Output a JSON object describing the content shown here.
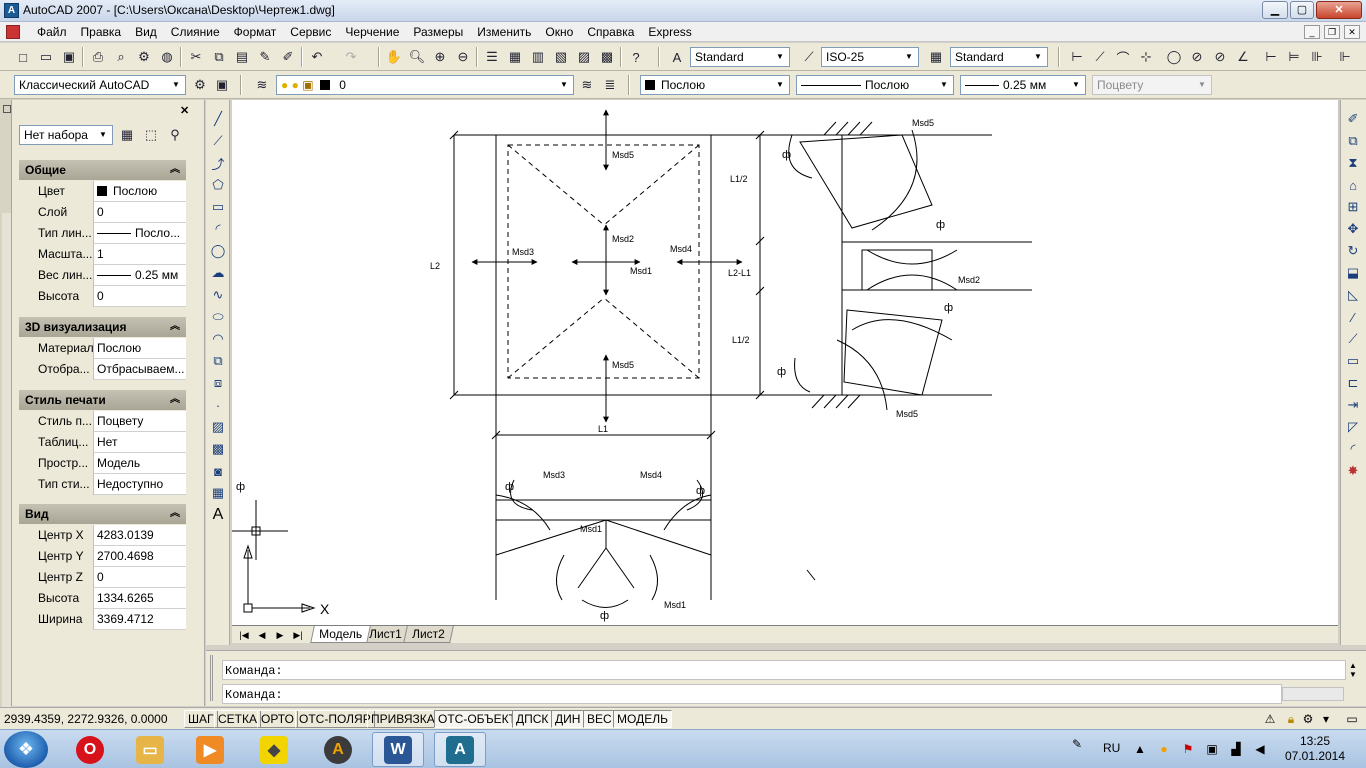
{
  "window": {
    "title": "AutoCAD 2007 - [C:\\Users\\Оксана\\Desktop\\Чертеж1.dwg]",
    "min": "▁",
    "max": "▢",
    "close": "✕"
  },
  "menu": [
    "Файл",
    "Правка",
    "Вид",
    "Слияние",
    "Формат",
    "Сервис",
    "Черчение",
    "Размеры",
    "Изменить",
    "Окно",
    "Справка",
    "Express"
  ],
  "toolbar": {
    "text_style": "Standard",
    "dim_style": "ISO-25",
    "table_style": "Standard",
    "workspace": "Классический AutoCAD",
    "layer": "0",
    "color": "Послою",
    "linetype": "Послою",
    "lineweight": "0.25 мм",
    "plotstyle": "Поцвету"
  },
  "properties": {
    "selection": "Нет набора",
    "sections": {
      "general": {
        "title": "Общие",
        "rows": [
          {
            "k": "Цвет",
            "v": "Послою"
          },
          {
            "k": "Слой",
            "v": "0"
          },
          {
            "k": "Тип лин...",
            "v": "Посло..."
          },
          {
            "k": "Масшта...",
            "v": "1"
          },
          {
            "k": "Вес лин...",
            "v": "0.25 мм"
          },
          {
            "k": "Высота",
            "v": "0"
          }
        ]
      },
      "viz3d": {
        "title": "3D визуализация",
        "rows": [
          {
            "k": "Материал",
            "v": "Послою"
          },
          {
            "k": "Отобра...",
            "v": "Отбрасываем..."
          }
        ]
      },
      "plot": {
        "title": "Стиль печати",
        "rows": [
          {
            "k": "Стиль п...",
            "v": "Поцвету"
          },
          {
            "k": "Таблиц...",
            "v": "Нет"
          },
          {
            "k": "Простр...",
            "v": "Модель"
          },
          {
            "k": "Тип сти...",
            "v": "Недоступно"
          }
        ]
      },
      "view": {
        "title": "Вид",
        "rows": [
          {
            "k": "Центр X",
            "v": "4283.0139"
          },
          {
            "k": "Центр Y",
            "v": "2700.4698"
          },
          {
            "k": "Центр Z",
            "v": "0"
          },
          {
            "k": "Высота",
            "v": "1334.6265"
          },
          {
            "k": "Ширина",
            "v": "3369.4712"
          }
        ]
      }
    }
  },
  "drawing": {
    "labels": {
      "msd5_top": "Msd5",
      "msd2": "Msd2",
      "msd3": "Msd3",
      "msd4": "Msd4",
      "msd1": "Msd1",
      "msd5_bottom": "Msd5",
      "l2": "L2",
      "l1_half_top": "L1/2",
      "l2_minus_l1": "L2-L1",
      "l1_half_bottom": "L1/2",
      "l1": "L1",
      "phi": "ф",
      "right_msd5_top": "Msd5",
      "right_msd2": "Msd2",
      "right_msd5_bottom": "Msd5",
      "bottom_msd3": "Msd3",
      "bottom_msd4": "Msd4",
      "bottom_msd1_center": "Msd1",
      "bottom_msd1_right": "Msd1"
    },
    "ucs_x": "X"
  },
  "tabs": [
    "Модель",
    "Лист1",
    "Лист2"
  ],
  "command": {
    "line1": "Команда:",
    "line2": "Команда:"
  },
  "status": {
    "coords": "2939.4359, 2272.9326, 0.0000",
    "toggles": [
      {
        "label": "ШАГ",
        "on": false
      },
      {
        "label": "СЕТКА",
        "on": false
      },
      {
        "label": "ОРТО",
        "on": false
      },
      {
        "label": "ОТС-ПОЛЯР",
        "on": false
      },
      {
        "label": "ПРИВЯЗКА",
        "on": false
      },
      {
        "label": "ОТС-ОБЪЕКТ",
        "on": true
      },
      {
        "label": "ДПСК",
        "on": true
      },
      {
        "label": "ДИН",
        "on": true
      },
      {
        "label": "ВЕС",
        "on": true
      },
      {
        "label": "МОДЕЛЬ",
        "on": true
      }
    ]
  },
  "taskbar": {
    "lang": "RU",
    "time": "13:25",
    "date": "07.01.2014"
  }
}
